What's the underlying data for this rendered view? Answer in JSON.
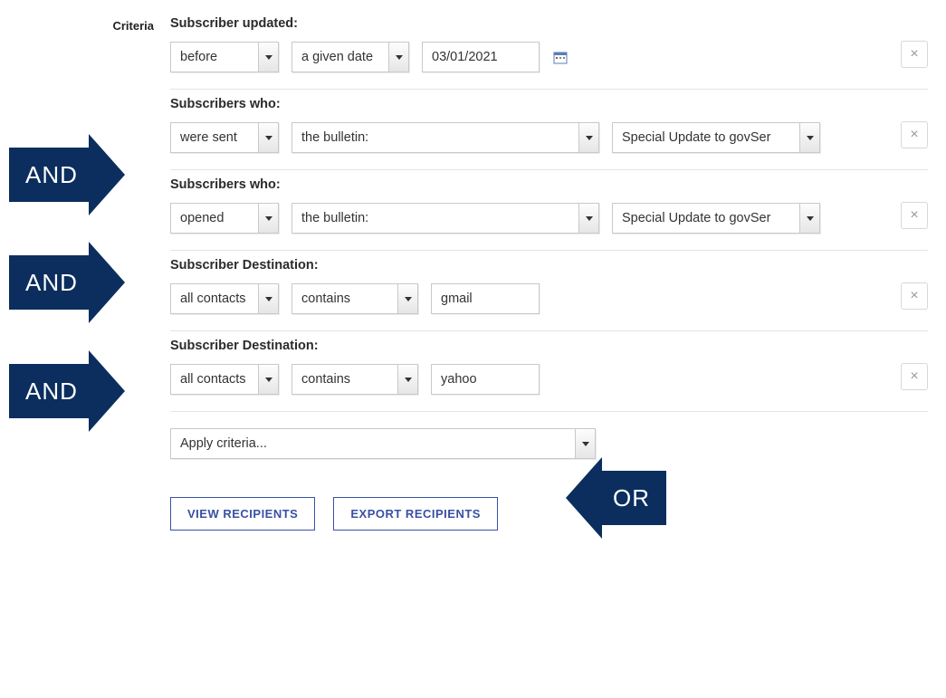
{
  "section_label": "Criteria",
  "criteria": [
    {
      "label": "Subscriber updated:",
      "selects": [
        {
          "value": "before",
          "width": "w-120"
        },
        {
          "value": "a given date",
          "width": "w-130"
        }
      ],
      "text_input": "03/01/2021",
      "has_calendar": true
    },
    {
      "label": "Subscribers who:",
      "selects": [
        {
          "value": "were sent",
          "width": "w-120"
        },
        {
          "value": "the bulletin:",
          "width": "w-340"
        },
        {
          "value": "Special Update to govSer",
          "width": "w-230"
        }
      ]
    },
    {
      "label": "Subscribers who:",
      "selects": [
        {
          "value": "opened",
          "width": "w-120"
        },
        {
          "value": "the bulletin:",
          "width": "w-340"
        },
        {
          "value": "Special Update to govSer",
          "width": "w-230"
        }
      ]
    },
    {
      "label": "Subscriber Destination:",
      "selects": [
        {
          "value": "all contacts",
          "width": "w-120"
        },
        {
          "value": "contains",
          "width": "w-140"
        }
      ],
      "text_input": "gmail"
    },
    {
      "label": "Subscriber Destination:",
      "selects": [
        {
          "value": "all contacts",
          "width": "w-120"
        },
        {
          "value": "contains",
          "width": "w-140"
        }
      ],
      "text_input": "yahoo"
    }
  ],
  "apply_select": "Apply criteria...",
  "buttons": {
    "view": "VIEW RECIPIENTS",
    "export": "EXPORT RECIPIENTS"
  },
  "annotations": {
    "and": "AND",
    "or": "OR"
  }
}
